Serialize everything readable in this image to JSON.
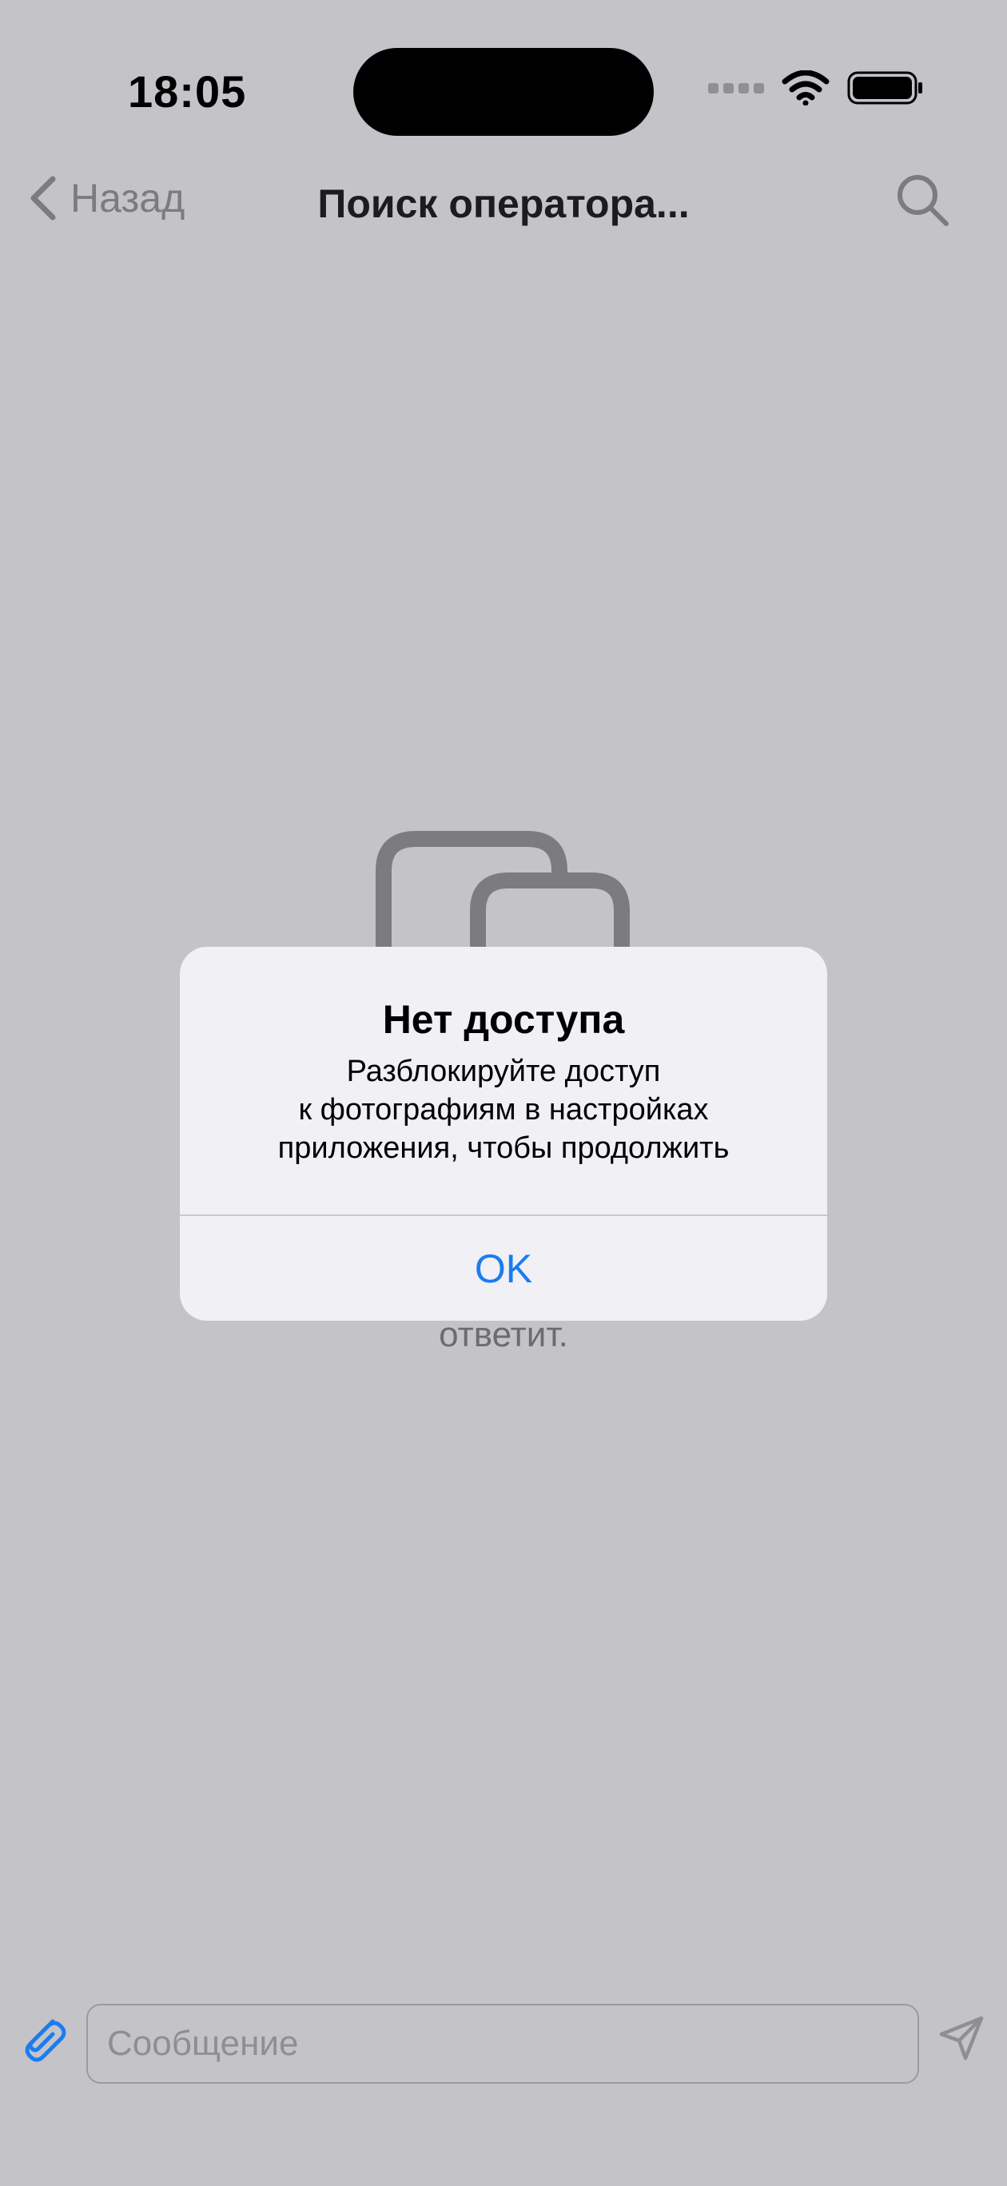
{
  "status_bar": {
    "time": "18:05",
    "icons": [
      "cellular-signal-icon",
      "wifi-icon",
      "battery-icon"
    ]
  },
  "nav": {
    "back_label": "Назад",
    "title": "Поиск оператора...",
    "search_icon": "search-icon"
  },
  "empty_state": {
    "icon": "photos-icon",
    "visible_text": "ответит."
  },
  "alert": {
    "title": "Нет доступа",
    "message": "Разблокируйте доступ\nк фотографиям в настройках\nприложения, чтобы продолжить",
    "ok_label": "OK"
  },
  "composer": {
    "placeholder": "Сообщение",
    "attach_icon": "paperclip-icon",
    "send_icon": "send-icon"
  },
  "colors": {
    "accent": "#1a7cf0",
    "dimmed_background": "#c4c3c8",
    "alert_background": "#f0f0f5"
  }
}
